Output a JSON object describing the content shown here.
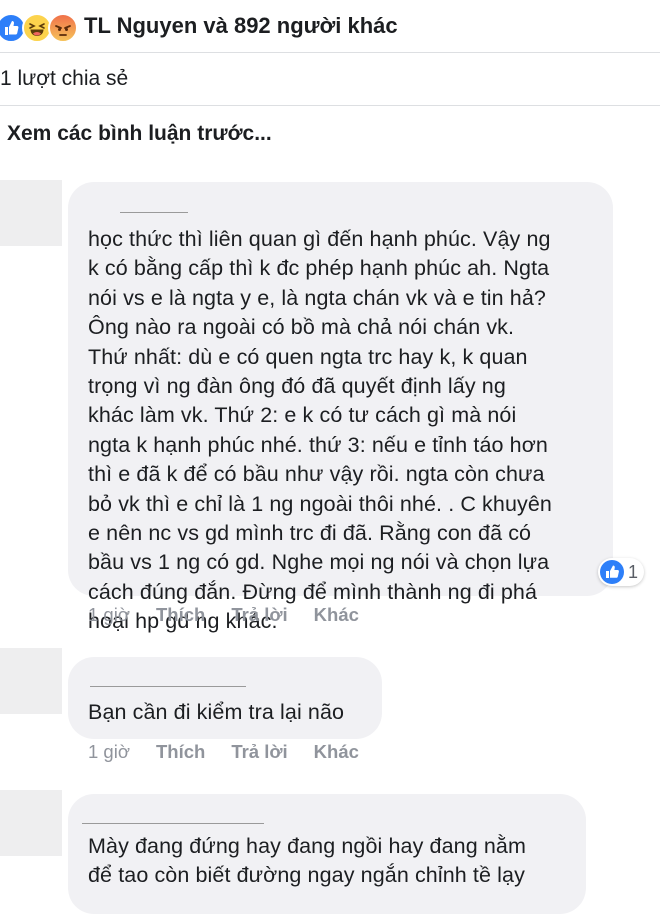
{
  "reactions": {
    "icons": [
      "like-icon",
      "haha-icon",
      "angry-icon"
    ],
    "text": "TL Nguyen và 892 người khác"
  },
  "shares": {
    "text": "1 lượt chia sẻ"
  },
  "previous_comments_label": "Xem các bình luận trước...",
  "comments": [
    {
      "text": "học thức thì liên quan gì đến hạnh phúc. Vậy ng\nk có bằng cấp thì k đc phép hạnh phúc ah. Ngta\nnói vs e là ngta y e, là ngta chán vk và e tin hả?\nÔng nào ra ngoài có bồ mà chả nói chán vk.\nThứ nhất: dù e có quen ngta trc hay k, k quan\ntrọng vì ng đàn ông đó đã quyết định lấy ng\nkhác làm vk. Thứ 2: e k có tư cách gì mà nói\nngta k hạnh phúc nhé. thứ 3: nếu e tỉnh táo hơn\nthì e đã k để có bầu như vậy rồi. ngta còn chưa\nbỏ vk thì e chỉ là 1 ng ngoài thôi nhé. . C khuyên\ne nên nc vs gd mình trc đi đã. Rằng con đã có\nbầu vs 1 ng có gd. Nghe mọi ng nói và chọn lựa\ncách đúng đắn. Đừng để mình thành ng đi phá\nhoại hp gd ng khác.",
      "time": "1 giờ",
      "like_label": "Thích",
      "reply_label": "Trả lời",
      "more_label": "Khác",
      "like_count": "1"
    },
    {
      "text": "Bạn cần đi kiểm tra lại não",
      "time": "1 giờ",
      "like_label": "Thích",
      "reply_label": "Trả lời",
      "more_label": "Khác"
    },
    {
      "text": "Mày đang đứng hay đang ngồi hay đang nằm\nđể tao còn biết đường ngay ngắn chỉnh tề lạy"
    }
  ],
  "colors": {
    "like_blue": "#2d7ff9",
    "bubble_bg": "#f1f1f4",
    "meta_gray": "#90949c",
    "divider": "#dddfe2"
  }
}
